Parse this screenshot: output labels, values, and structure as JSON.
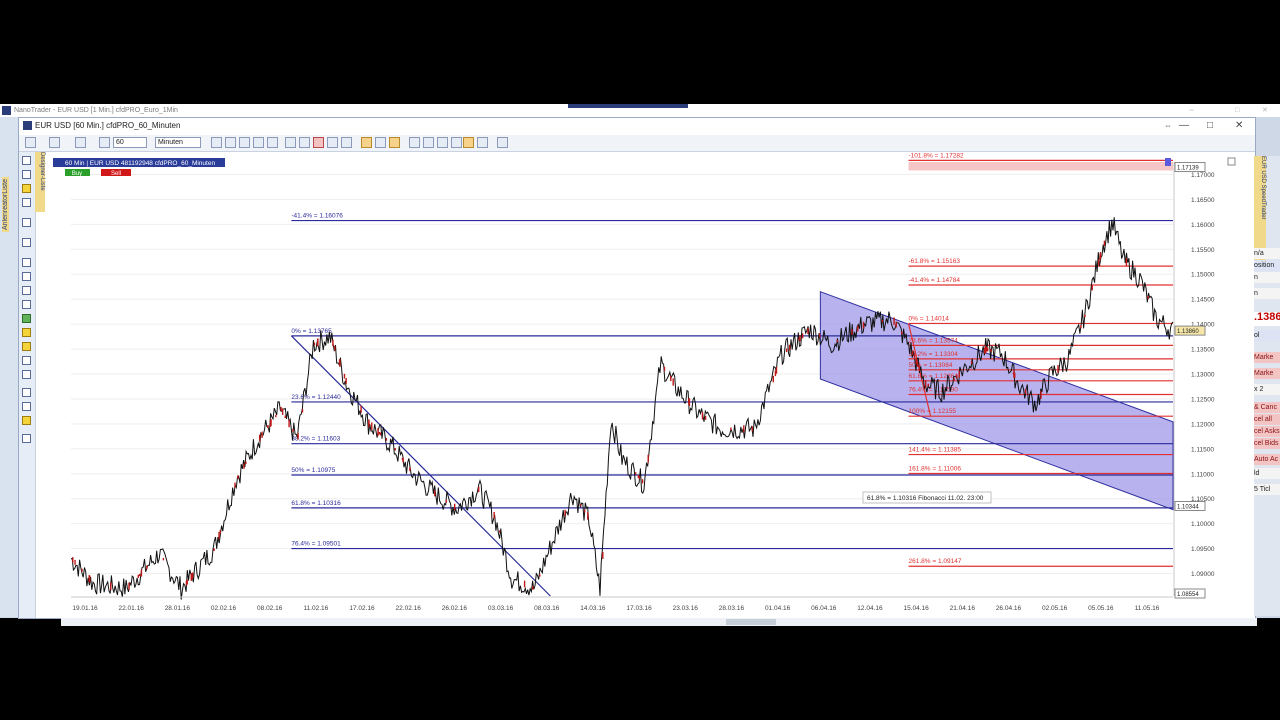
{
  "outer_window": {
    "title": "NanoTrader - EUR USD [1 Min.]   cfdPRO_Euro_1Min",
    "side_tab": "AnlenreatorListe"
  },
  "chart_window": {
    "title": "EUR USD [60 Min.]   cfdPRO_60_Minuten",
    "info_label": "60 Min | EUR USD   481192948 cfdPRO_60_Minuten",
    "buy_label": "Buy",
    "sell_label": "Sell",
    "toolbar": {
      "interval_value": "60",
      "unit_value": "Minuten"
    },
    "drawing_label": "Designer-Liste"
  },
  "right_panel": {
    "speedtrader_label": "EUR USD   SpeedTrader",
    "items": [
      "n/a",
      "osition",
      "n",
      "n",
      ".1386",
      "ol",
      "Marke",
      "Marke",
      "x 2",
      "& Canc",
      "cel all",
      "cel Asks",
      "cel Bids",
      "Auto Ac",
      "ld",
      "5 Ticl"
    ]
  },
  "colors": {
    "fib_blue": "#2a2a9a",
    "fib_red": "#e03030",
    "channel_fill": "#9a93e8",
    "chart_bg": "#ffffff"
  },
  "chart_data": {
    "type": "line",
    "series_style": "candlestick (60 min)",
    "x_ticks": [
      "19.01.16",
      "22.01.16",
      "28.01.16",
      "02.02.16",
      "08.02.16",
      "11.02.16",
      "17.02.16",
      "22.02.16",
      "26.02.16",
      "03.03.16",
      "08.03.16",
      "14.03.16",
      "17.03.16",
      "23.03.16",
      "28.03.16",
      "01.04.16",
      "06.04.16",
      "12.04.16",
      "15.04.16",
      "21.04.16",
      "26.04.16",
      "02.05.16",
      "05.05.16",
      "11.05.16"
    ],
    "y_ticks": [
      "1.17000",
      "1.16500",
      "1.16000",
      "1.15500",
      "1.15000",
      "1.14500",
      "1.14000",
      "1.13500",
      "1.13000",
      "1.12500",
      "1.12000",
      "1.11500",
      "1.11000",
      "1.10500",
      "1.10000",
      "1.09500",
      "1.09000"
    ],
    "ylim": [
      1.0855,
      1.1725
    ],
    "price_path": [
      [
        0,
        1.093
      ],
      [
        0.02,
        1.088
      ],
      [
        0.05,
        1.087
      ],
      [
        0.08,
        1.094
      ],
      [
        0.1,
        1.087
      ],
      [
        0.13,
        1.095
      ],
      [
        0.15,
        1.109
      ],
      [
        0.17,
        1.117
      ],
      [
        0.19,
        1.123
      ],
      [
        0.205,
        1.117
      ],
      [
        0.22,
        1.136
      ],
      [
        0.235,
        1.1375
      ],
      [
        0.25,
        1.128
      ],
      [
        0.27,
        1.12
      ],
      [
        0.29,
        1.116
      ],
      [
        0.31,
        1.11
      ],
      [
        0.33,
        1.106
      ],
      [
        0.35,
        1.103
      ],
      [
        0.37,
        1.107
      ],
      [
        0.385,
        1.101
      ],
      [
        0.4,
        1.089
      ],
      [
        0.42,
        1.087
      ],
      [
        0.44,
        1.098
      ],
      [
        0.455,
        1.106
      ],
      [
        0.47,
        1.101
      ],
      [
        0.48,
        1.087
      ],
      [
        0.49,
        1.121
      ],
      [
        0.5,
        1.113
      ],
      [
        0.52,
        1.108
      ],
      [
        0.535,
        1.132
      ],
      [
        0.55,
        1.127
      ],
      [
        0.57,
        1.122
      ],
      [
        0.59,
        1.119
      ],
      [
        0.62,
        1.119
      ],
      [
        0.645,
        1.134
      ],
      [
        0.67,
        1.139
      ],
      [
        0.69,
        1.136
      ],
      [
        0.72,
        1.14
      ],
      [
        0.745,
        1.141
      ],
      [
        0.76,
        1.136
      ],
      [
        0.775,
        1.128
      ],
      [
        0.79,
        1.1265
      ],
      [
        0.81,
        1.131
      ],
      [
        0.83,
        1.135
      ],
      [
        0.845,
        1.134
      ],
      [
        0.86,
        1.128
      ],
      [
        0.875,
        1.124
      ],
      [
        0.89,
        1.13
      ],
      [
        0.905,
        1.133
      ],
      [
        0.92,
        1.142
      ],
      [
        0.935,
        1.155
      ],
      [
        0.945,
        1.1605
      ],
      [
        0.955,
        1.153
      ],
      [
        0.97,
        1.149
      ],
      [
        0.985,
        1.141
      ],
      [
        1.0,
        1.1386
      ]
    ],
    "channel": {
      "upper": [
        [
          1.0,
          1.1465
        ],
        [
          1.0,
          1.121
        ]
      ],
      "note": "falling channel 12.04.16 → 11.05.16"
    },
    "annotations": {
      "blue_fib": [
        {
          "label": "-41.4% = 1.16076",
          "value": 1.16076
        },
        {
          "label": "0% = 1.13765",
          "value": 1.13765
        },
        {
          "label": "23.6% = 1.12440",
          "value": 1.1244
        },
        {
          "label": "38.2% = 1.11603",
          "value": 1.11603
        },
        {
          "label": "50% = 1.10975",
          "value": 1.10975
        },
        {
          "label": "61.8% = 1.10316",
          "value": 1.10316
        },
        {
          "label": "76.4% = 1.09501",
          "value": 1.09501
        }
      ],
      "red_fib": [
        {
          "label": "-101.8% = 1.17282",
          "value": 1.17282
        },
        {
          "label": "-61.8% = 1.15163",
          "value": 1.15163
        },
        {
          "label": "-41.4% = 1.14784",
          "value": 1.14784
        },
        {
          "label": "0% = 1.14014",
          "value": 1.14014
        },
        {
          "label": "23.6% = 1.13574",
          "value": 1.13574
        },
        {
          "label": "38.2% = 1.13304",
          "value": 1.13304
        },
        {
          "label": "50% = 1.13084",
          "value": 1.13084
        },
        {
          "label": "61.8% = 1.12864",
          "value": 1.12864
        },
        {
          "label": "76.4% = 1.12590",
          "value": 1.1259
        },
        {
          "label": "100% = 1.12155",
          "value": 1.12155
        },
        {
          "label": "141.4% = 1.11385",
          "value": 1.11385
        },
        {
          "label": "161.8% = 1.11006",
          "value": 1.11006
        },
        {
          "label": "261.8% = 1.09147",
          "value": 1.09147
        }
      ],
      "tooltip": "61.8% = 1.10316 Fibonacci 11.02. 23:00",
      "price_boxes": [
        "1.17139",
        "1.13860",
        "1.10344",
        "1.08554"
      ]
    }
  }
}
